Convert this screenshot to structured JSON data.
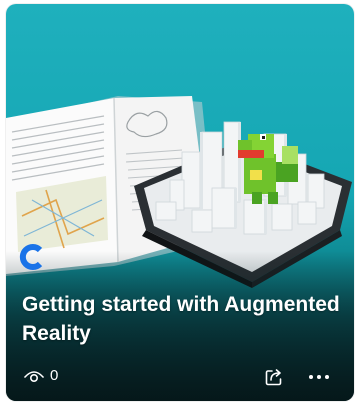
{
  "card": {
    "title": "Getting started with Augmented Reality",
    "views_count": "0",
    "thumbnail_icon": "ar-book-city-illustration",
    "brand_logo_icon": "c-logo-icon",
    "views_icon": "eye-icon",
    "share_icon": "share-icon",
    "more_icon": "more-options-icon"
  },
  "colors": {
    "card_top": "#1fb0bd",
    "card_bottom": "#082f33",
    "text": "#ffffff",
    "logo_blue": "#1a73e8"
  }
}
